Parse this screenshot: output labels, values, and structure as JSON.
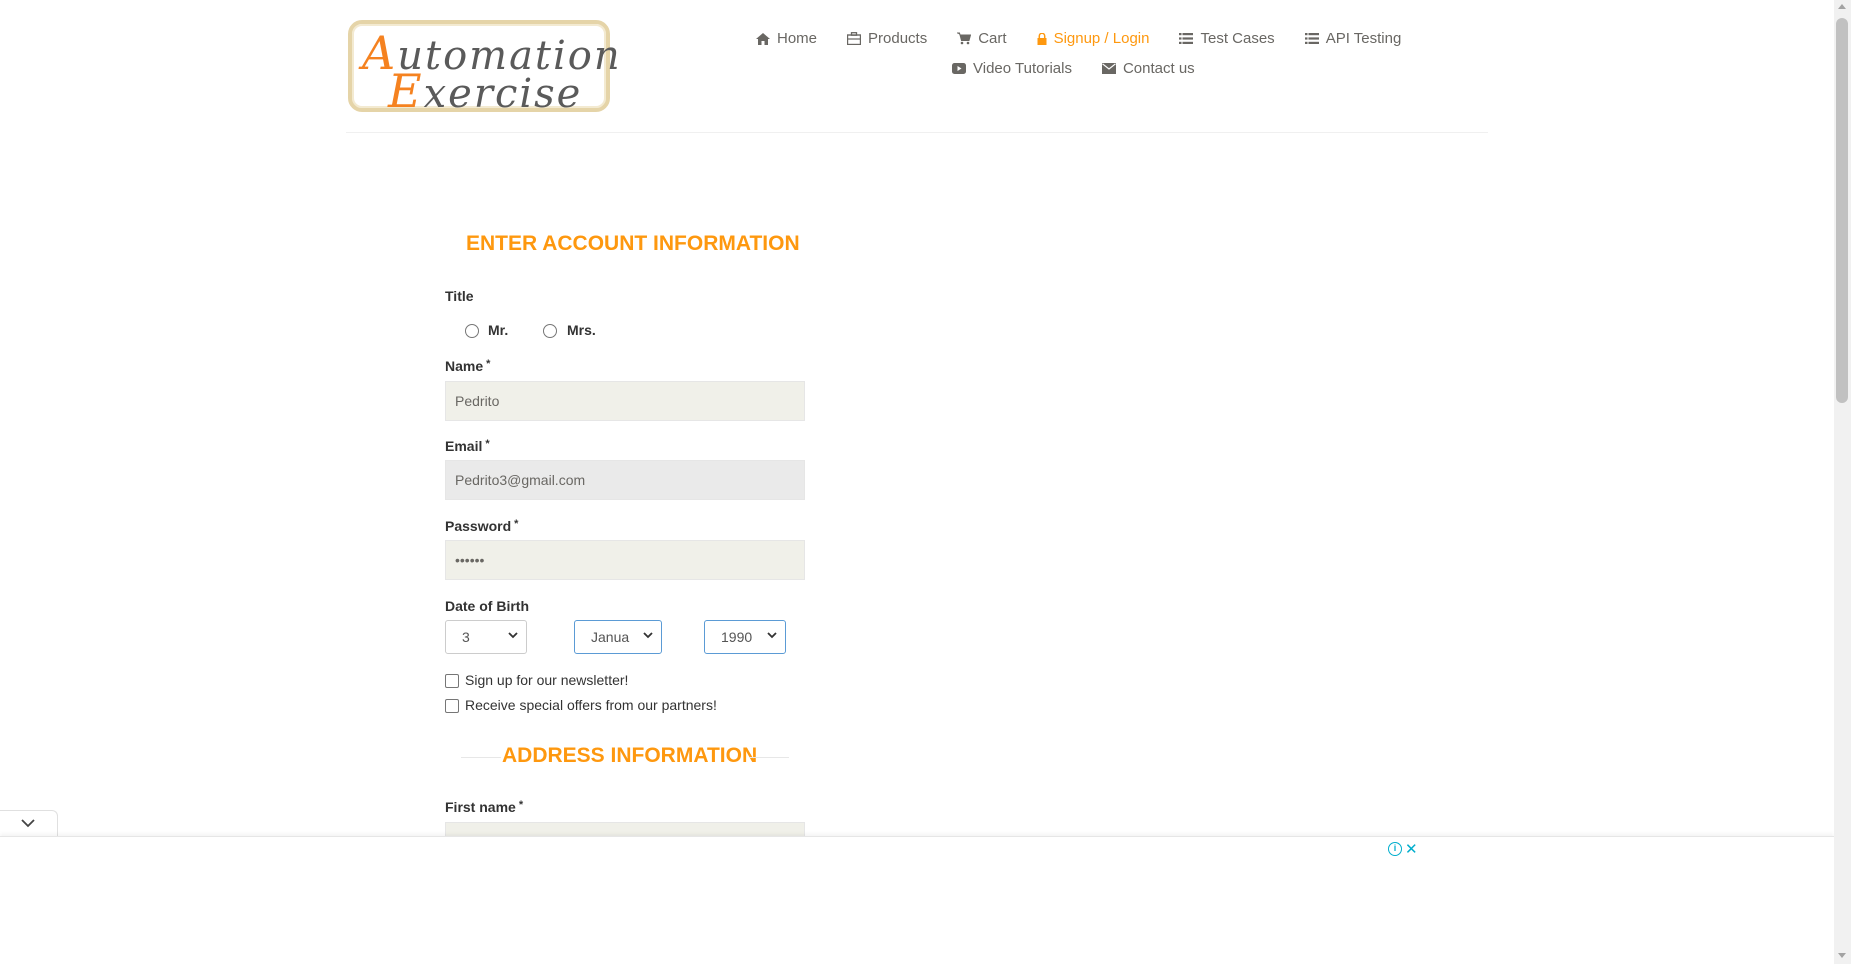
{
  "header": {
    "logo": {
      "line1": "Automation",
      "line2": "Exercise"
    },
    "nav": {
      "home": "Home",
      "products": "Products",
      "cart": "Cart",
      "signup_login": "Signup / Login",
      "test_cases": "Test Cases",
      "api_testing": "API Testing",
      "video_tutorials": "Video Tutorials",
      "contact_us": "Contact us"
    },
    "active_nav": "signup_login",
    "accent_color": "#fe980f"
  },
  "form": {
    "heading": "ENTER ACCOUNT INFORMATION",
    "title_label": "Title",
    "title_options": {
      "mr": "Mr.",
      "mrs": "Mrs."
    },
    "name_label": "Name",
    "name_value": "Pedrito",
    "email_label": "Email",
    "email_value": "Pedrito3@gmail.com",
    "password_label": "Password",
    "password_value": "••••••",
    "required_mark": "*",
    "dob_label": "Date of Birth",
    "dob_day": "3",
    "dob_month": "Janua",
    "dob_year": "1990",
    "newsletter_label": "Sign up for our newsletter!",
    "offers_label": "Receive special offers from our partners!",
    "address_heading": "ADDRESS INFORMATION",
    "first_name_label": "First name"
  },
  "ad": {
    "info_icon": "i",
    "close_icon": "✕"
  }
}
